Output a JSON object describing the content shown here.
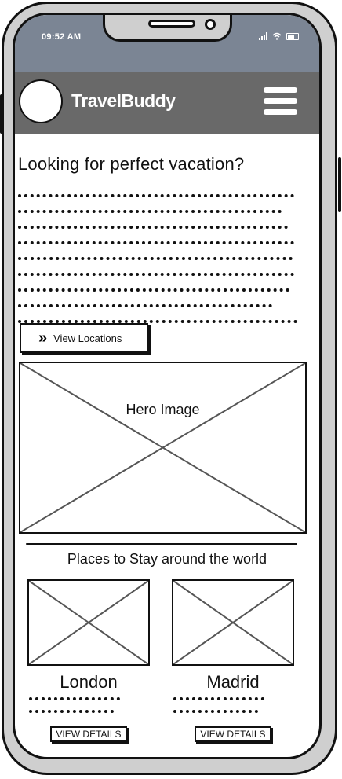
{
  "status_bar": {
    "time": "09:52 AM"
  },
  "app": {
    "brand": "TravelBuddy"
  },
  "hero_section": {
    "title": "Looking for perfect vacation?",
    "cta_label": "View Locations",
    "image_label": "Hero Image"
  },
  "places": {
    "section_title": "Places to Stay around the world",
    "cards": [
      {
        "name": "London",
        "button_label": "VIEW DETAILS"
      },
      {
        "name": "Madrid",
        "button_label": "VIEW DETAILS"
      }
    ]
  },
  "icons": [
    "wifi-icon",
    "battery-icon",
    "signal-icon",
    "hamburger-menu-icon",
    "chevron-double-right-icon"
  ]
}
